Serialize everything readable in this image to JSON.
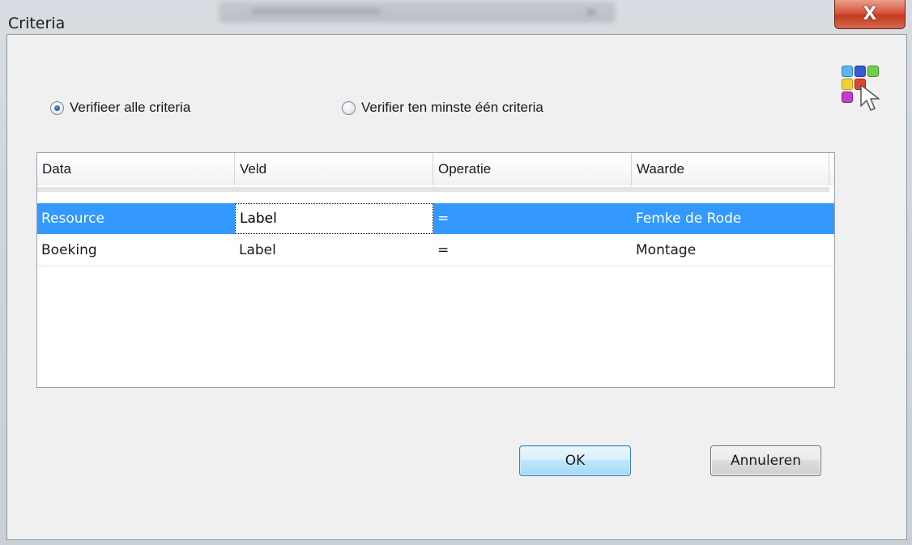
{
  "window": {
    "title": "Criteria",
    "close_glyph": "X"
  },
  "options": {
    "verify_all_label": "Verifieer alle criteria",
    "verify_any_label": "Verifier ten minste één criteria",
    "selected": "verify_all"
  },
  "grid": {
    "columns": [
      "Data",
      "Veld",
      "Operatie",
      "Waarde"
    ],
    "rows": [
      {
        "data": "Resource",
        "veld": "Label",
        "operatie": "=",
        "waarde": "Femke de Rode",
        "selected": true
      },
      {
        "data": "Boeking",
        "veld": "Label",
        "operatie": "=",
        "waarde": "Montage",
        "selected": false
      }
    ]
  },
  "buttons": {
    "ok_label": "OK",
    "cancel_label": "Annuleren"
  },
  "icons": {
    "palette": "color-grid-cursor-icon",
    "close": "close-icon"
  },
  "colors": {
    "selection": "#3399ff",
    "close_button": "#c43a1e",
    "palette": [
      "#5bb6f0",
      "#3a59d6",
      "#6fd04e",
      "#f3cf36",
      "#e2432f",
      "#c240c8"
    ]
  }
}
